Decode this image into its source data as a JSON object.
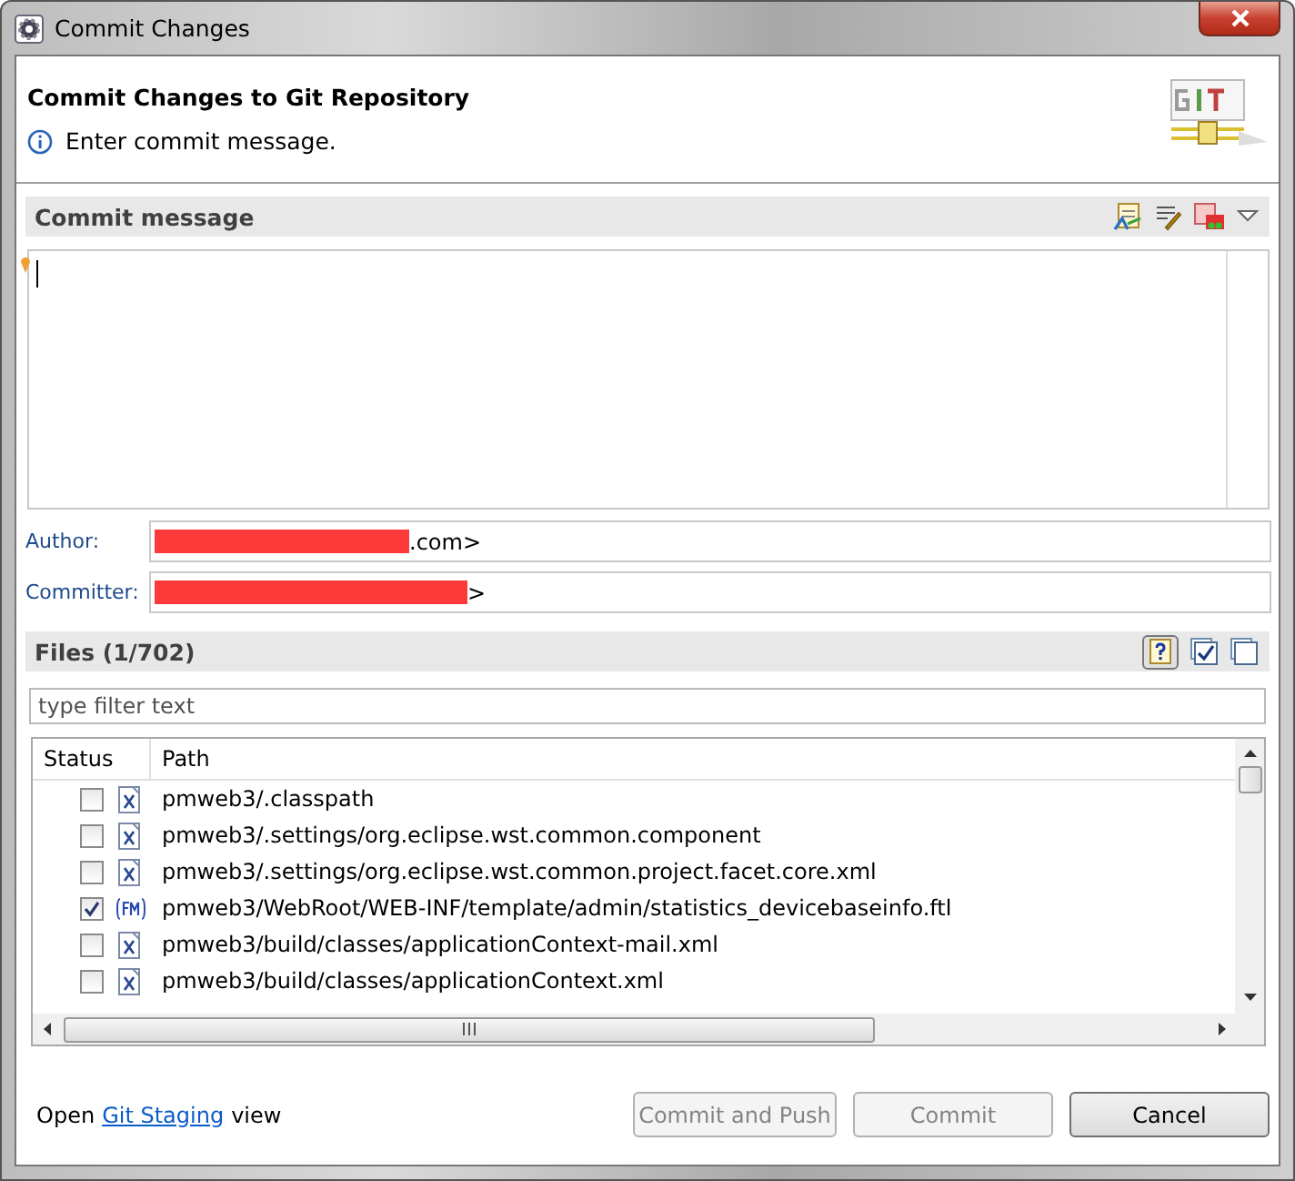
{
  "window": {
    "title": "Commit Changes"
  },
  "header": {
    "title": "Commit Changes to Git Repository",
    "message": "Enter commit message."
  },
  "commit_message": {
    "title": "Commit message"
  },
  "author": {
    "label": "Author:",
    "value": ".com>",
    "redacted": true
  },
  "committer": {
    "label": "Committer:",
    "value": ">",
    "redacted": true
  },
  "files": {
    "title": "Files (1/702)",
    "filter_placeholder": "type filter text",
    "columns": [
      "Status",
      "Path"
    ],
    "rows": [
      {
        "checked": false,
        "kind": "xml",
        "path": "pmweb3/.classpath"
      },
      {
        "checked": false,
        "kind": "xml",
        "path": "pmweb3/.settings/org.eclipse.wst.common.component"
      },
      {
        "checked": false,
        "kind": "xml",
        "path": "pmweb3/.settings/org.eclipse.wst.common.project.facet.core.xml"
      },
      {
        "checked": true,
        "kind": "ftl",
        "path": "pmweb3/WebRoot/WEB-INF/template/admin/statistics_devicebaseinfo.ftl"
      },
      {
        "checked": false,
        "kind": "xml",
        "path": "pmweb3/build/classes/applicationContext-mail.xml"
      },
      {
        "checked": false,
        "kind": "xml",
        "path": "pmweb3/build/classes/applicationContext.xml"
      }
    ]
  },
  "footer": {
    "prefix": "Open",
    "link": "Git Staging",
    "suffix": "view"
  },
  "buttons": [
    {
      "label": "Commit and Push",
      "disabled": true
    },
    {
      "label": "Commit",
      "disabled": true
    },
    {
      "label": "Cancel",
      "disabled": false
    }
  ]
}
